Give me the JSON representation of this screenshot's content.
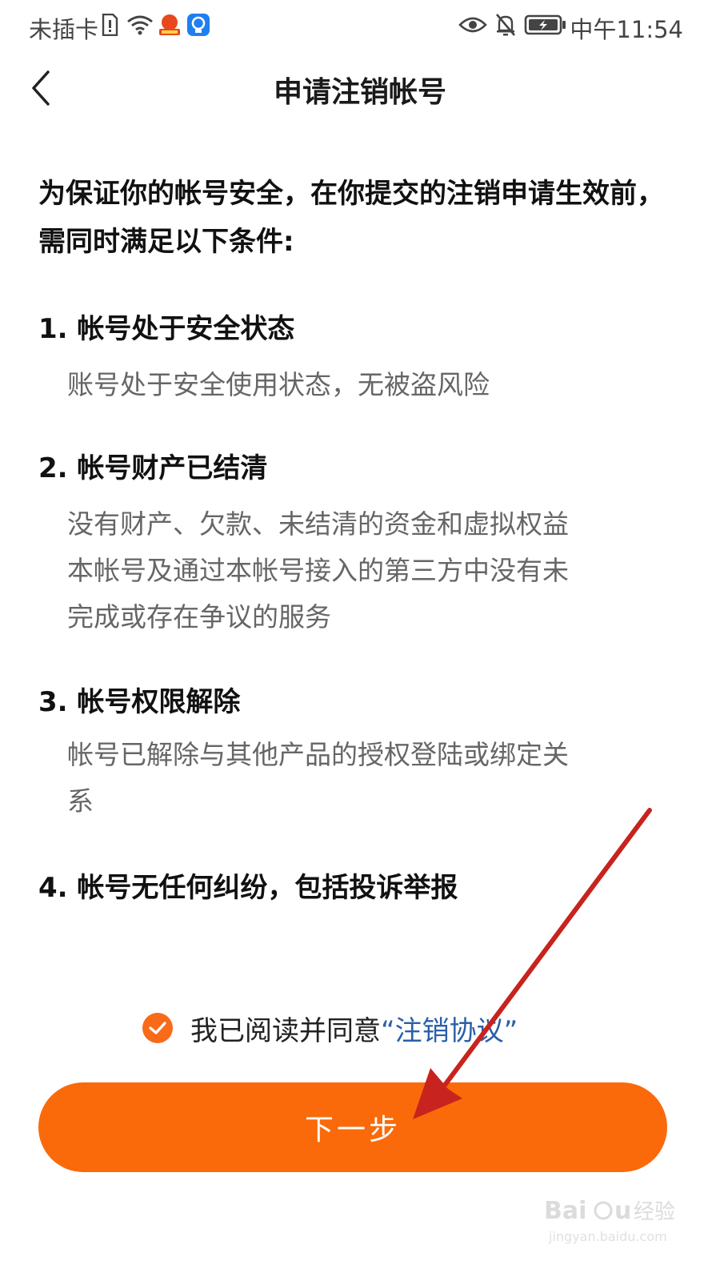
{
  "status_bar": {
    "carrier": "未插卡",
    "time": "中午11:54",
    "icons": [
      "sim-alert-icon",
      "wifi-icon",
      "app-badge-icon",
      "bulb-icon",
      "eye-icon",
      "mute-bell-icon",
      "battery-charging-icon"
    ]
  },
  "header": {
    "title": "申请注销帐号",
    "back_icon": "chevron-left-icon"
  },
  "intro": "为保证你的帐号安全，在你提交的注销申请生效前，需同时满足以下条件:",
  "conditions": [
    {
      "title": "1. 帐号处于安全状态",
      "lines": [
        "账号处于安全使用状态，无被盗风险"
      ]
    },
    {
      "title": "2. 帐号财产已结清",
      "lines": [
        "没有财产、欠款、未结清的资金和虚拟权益",
        "本帐号及通过本帐号接入的第三方中没有未",
        "完成或存在争议的服务"
      ]
    },
    {
      "title": "3. 帐号权限解除",
      "lines": [
        "帐号已解除与其他产品的授权登陆或绑定关",
        "系"
      ]
    },
    {
      "title": "4. 帐号无任何纠纷，包括投诉举报",
      "lines": []
    }
  ],
  "agreement": {
    "checked": true,
    "text": "我已阅读并同意",
    "link": "“注销协议”"
  },
  "next_button": {
    "label": "下一步"
  },
  "colors": {
    "accent": "#fa6a0a",
    "link": "#2a5fa8",
    "annotation": "#c8231e"
  }
}
